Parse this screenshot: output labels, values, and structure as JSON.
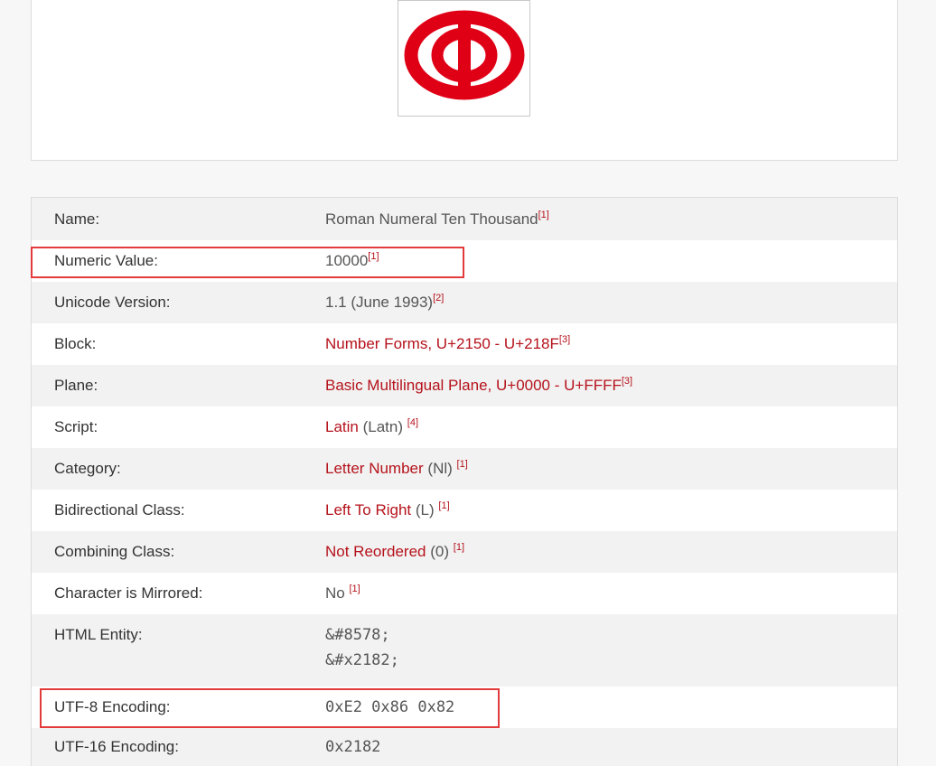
{
  "glyph": {
    "character": "ↂ",
    "icon": "roman-numeral-ten-thousand-glyph",
    "color": "#e00016"
  },
  "properties": {
    "name": {
      "label": "Name:",
      "value": "Roman Numeral Ten Thousand",
      "ref": "[1]"
    },
    "numeric_value": {
      "label": "Numeric Value:",
      "value": "10000",
      "ref": "[1]"
    },
    "unicode_version": {
      "label": "Unicode Version:",
      "value": "1.1 (June 1993)",
      "ref": "[2]"
    },
    "block": {
      "label": "Block:",
      "value": "Number Forms, U+2150 - U+218F",
      "ref": "[3]"
    },
    "plane": {
      "label": "Plane:",
      "value": "Basic Multilingual Plane, U+0000 - U+FFFF",
      "ref": "[3]"
    },
    "script": {
      "label": "Script:",
      "link": "Latin",
      "extra": "(Latn)",
      "ref": "[4]"
    },
    "category": {
      "label": "Category:",
      "link": "Letter Number",
      "extra": "(Nl)",
      "ref": "[1]"
    },
    "bidi": {
      "label": "Bidirectional Class:",
      "link": "Left To Right",
      "extra": "(L)",
      "ref": "[1]"
    },
    "combining": {
      "label": "Combining Class:",
      "link": "Not Reordered",
      "extra": "(0)",
      "ref": "[1]"
    },
    "mirrored": {
      "label": "Character is Mirrored:",
      "value": "No",
      "ref": "[1]"
    },
    "html_entity": {
      "label": "HTML Entity:",
      "values": [
        "&#8578;",
        "&#x2182;"
      ]
    },
    "utf8": {
      "label": "UTF-8 Encoding:",
      "value": "0xE2 0x86 0x82"
    },
    "utf16": {
      "label": "UTF-16 Encoding:",
      "value": "0x2182"
    }
  },
  "highlight_color": "#e33b3b",
  "link_color": "#b5121b",
  "code_color": "#1f5c86"
}
